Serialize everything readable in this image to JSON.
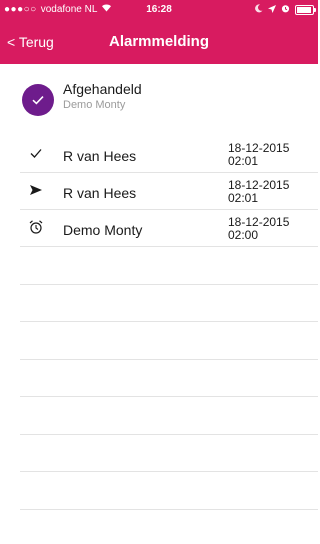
{
  "status_bar": {
    "carrier": "vodafone NL",
    "time": "16:28",
    "signal_dots": "●●●○○"
  },
  "nav": {
    "back_label": "< Terug",
    "title": "Alarmmelding"
  },
  "alarm": {
    "status": "Afgehandeld",
    "subject": "Demo Monty"
  },
  "events": [
    {
      "icon": "checkmark-icon",
      "name": "R van Hees",
      "date": "18-12-2015",
      "time": "02:01"
    },
    {
      "icon": "send-icon",
      "name": "R van Hees",
      "date": "18-12-2015",
      "time": "02:01"
    },
    {
      "icon": "alarm-clock-icon",
      "name": "Demo Monty",
      "date": "18-12-2015",
      "time": "02:00"
    }
  ],
  "colors": {
    "accent": "#d81b60",
    "avatar": "#6e1c8c"
  }
}
